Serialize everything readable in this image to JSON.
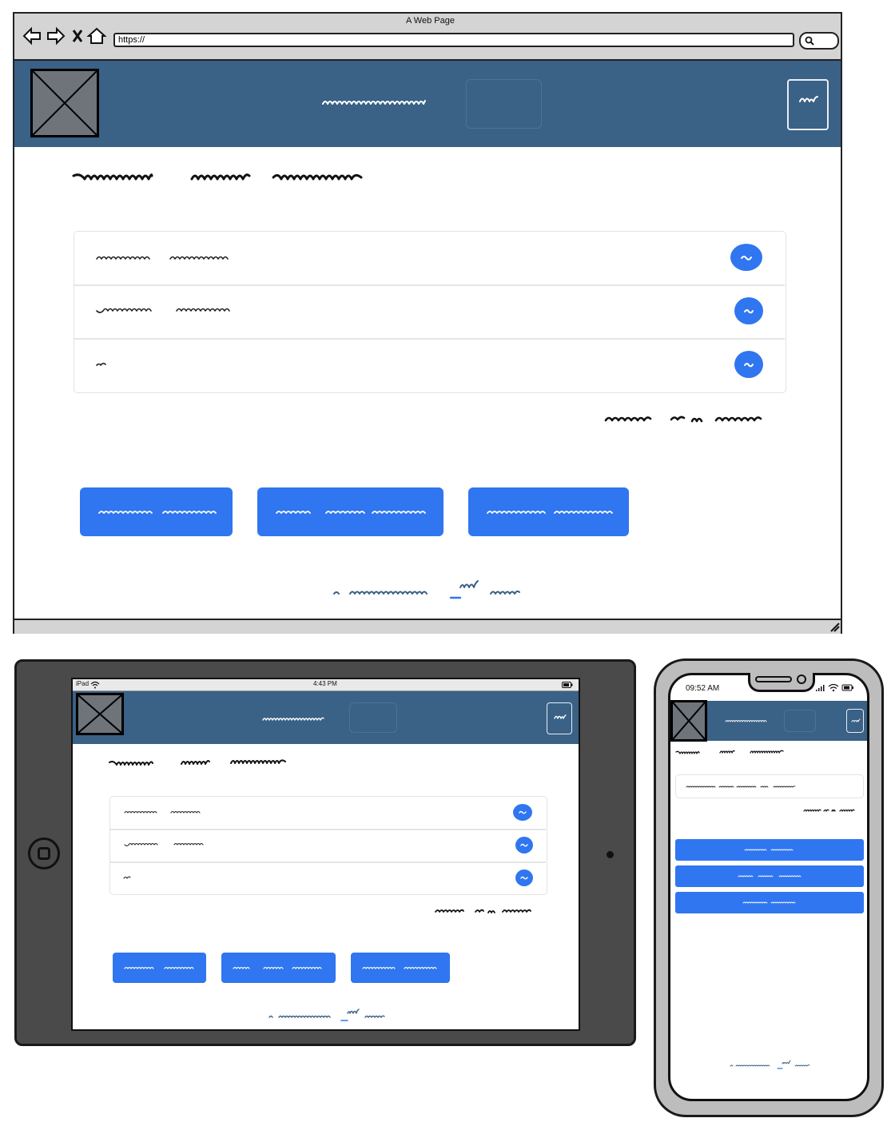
{
  "desktop": {
    "window_title": "A Web Page",
    "url": "https://"
  },
  "tablet": {
    "device_label": "iPad",
    "time": "4:43 PM"
  },
  "phone": {
    "time": "09:52 AM"
  },
  "colors": {
    "header_blue": "#3a6186",
    "button_blue": "#2f76f0",
    "chrome_gray": "#d4d4d4",
    "device_dark": "#4a4a4a"
  },
  "icons": [
    "back-arrow-icon",
    "forward-arrow-icon",
    "close-icon",
    "home-icon",
    "search-icon",
    "image-placeholder-icon",
    "menu-icon",
    "wifi-icon",
    "battery-icon",
    "signal-icon",
    "home-button-icon",
    "resize-grip-icon"
  ]
}
